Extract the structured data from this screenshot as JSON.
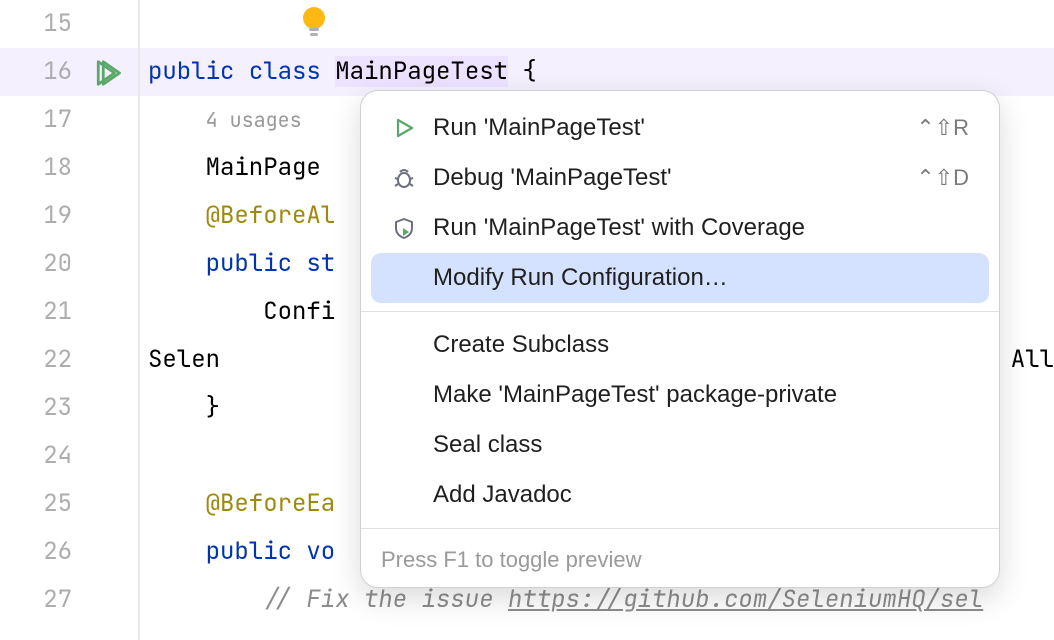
{
  "gutter": {
    "lines": [
      "15",
      "16",
      "17",
      "18",
      "19",
      "20",
      "21",
      "22",
      "23",
      "24",
      "25",
      "26",
      "27"
    ]
  },
  "code": {
    "usages": "4 usages",
    "kw_public": "public",
    "kw_class": "class",
    "classname": "MainPageTest",
    "brace_open": " {",
    "line17": "MainPage ",
    "ann_beforeAll": "@BeforeAl",
    "kw_static_partial": "public st",
    "line21": "Confi",
    "line22": "Selen",
    "line22_tail": "All",
    "brace_close": "}",
    "ann_beforeEach": "@BeforeEa",
    "kw_void_partial": "public vo",
    "comment_fix": "// Fix the issue ",
    "comment_link": "https://github.com/SeleniumHQ/sel"
  },
  "menu": {
    "run": "Run 'MainPageTest'",
    "run_shortcut": "⌃⇧R",
    "debug": "Debug 'MainPageTest'",
    "debug_shortcut": "⌃⇧D",
    "coverage": "Run 'MainPageTest' with Coverage",
    "modify": "Modify Run Configuration…",
    "create_subclass": "Create Subclass",
    "package_private": "Make 'MainPageTest' package-private",
    "seal": "Seal class",
    "javadoc": "Add Javadoc",
    "footer": "Press F1 to toggle preview"
  }
}
